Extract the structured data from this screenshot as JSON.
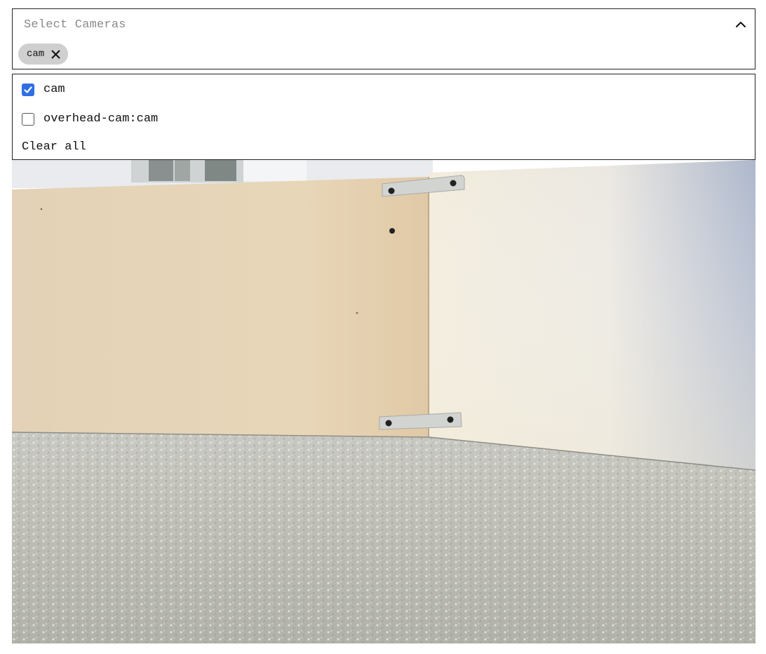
{
  "select": {
    "placeholder": "Select Cameras",
    "chevron_icon": "chevron-up-icon",
    "chips": [
      {
        "label": "cam",
        "remove_icon": "close-icon"
      }
    ]
  },
  "dropdown": {
    "options": [
      {
        "label": "cam",
        "checked": true
      },
      {
        "label": "overhead-cam:cam",
        "checked": false
      }
    ],
    "clear_all_label": "Clear all"
  },
  "colors": {
    "checkbox_accent": "#2f6fe4",
    "chip_background": "#cfcfcf",
    "border": "#222222",
    "placeholder": "#8a8a8a"
  }
}
